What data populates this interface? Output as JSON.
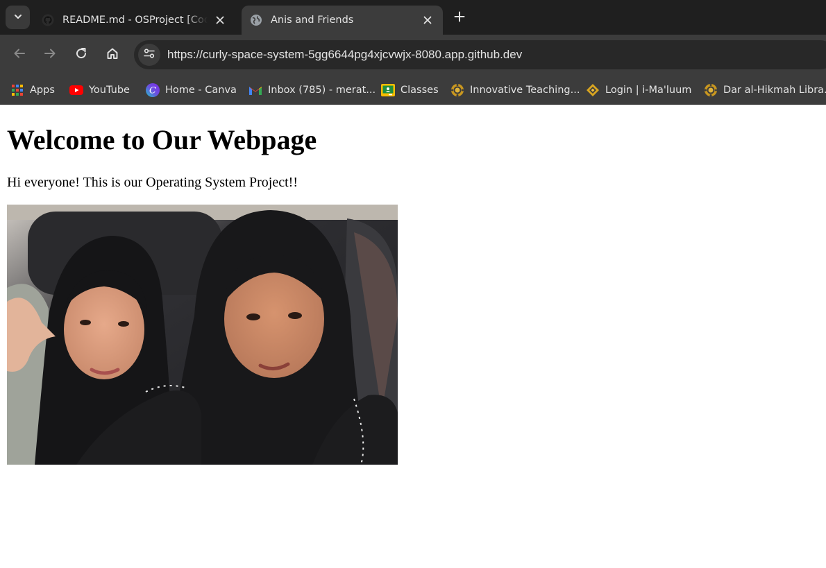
{
  "browser": {
    "tabs": [
      {
        "title": "README.md - OSProject [Codespaces]",
        "favicon": "github-icon",
        "active": false
      },
      {
        "title": "Anis and Friends",
        "favicon": "globe-icon",
        "active": true
      }
    ],
    "url": "https://curly-space-system-5gg6644pg4xjcvwjx-8080.app.github.dev",
    "bookmarks": [
      {
        "label": "Apps",
        "icon": "apps-grid-icon"
      },
      {
        "label": "YouTube",
        "icon": "youtube-icon"
      },
      {
        "label": "Home - Canva",
        "icon": "canva-icon"
      },
      {
        "label": "Inbox (785) - merat...",
        "icon": "gmail-icon"
      },
      {
        "label": "Classes",
        "icon": "classroom-icon"
      },
      {
        "label": "Innovative Teaching...",
        "icon": "emblem-icon"
      },
      {
        "label": "Login | i-Ma'luum",
        "icon": "diamond-logo-icon"
      },
      {
        "label": "Dar al-Hikmah Libra...",
        "icon": "emblem-icon"
      }
    ],
    "colors": {
      "tabstrip": "#1f1f1f",
      "toolbar": "#3c3c3c",
      "omnibox": "#282828",
      "text": "#e3e3e3"
    }
  },
  "page": {
    "heading": "Welcome to Our Webpage",
    "intro": "Hi everyone! This is our Operating System Project!!",
    "photo": "photo of two friends in car"
  }
}
